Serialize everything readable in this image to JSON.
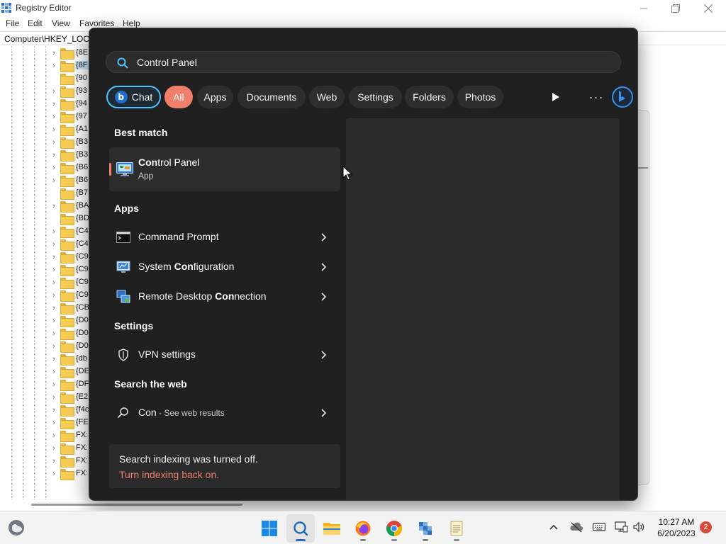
{
  "regedit": {
    "title": "Registry Editor",
    "menu": [
      "File",
      "Edit",
      "View",
      "Favorites",
      "Help"
    ],
    "address": "Computer\\HKEY_LOCA",
    "tree_items": [
      "{8E",
      "{8F",
      "{90",
      "{93",
      "{94",
      "{97",
      "{A1",
      "{B3",
      "{B3",
      "{B6",
      "{B6",
      "{B7",
      "{BA",
      "{BD",
      "{C4",
      "{C4",
      "{C9",
      "{C9",
      "{C9",
      "{C9",
      "{CB",
      "{D0",
      "{D0",
      "{D0",
      "{db",
      "{DE",
      "{DF",
      "{E2",
      "{f4c",
      "{FE",
      "FX:",
      "FX:",
      "FX:",
      "FX:"
    ],
    "selected_index": 1
  },
  "search": {
    "query": "Control Panel",
    "filters": [
      "Chat",
      "All",
      "Apps",
      "Documents",
      "Web",
      "Settings",
      "Folders",
      "Photos"
    ],
    "active_filter": "All",
    "more_label": "···",
    "best_match": {
      "heading": "Best match",
      "name_bold": "Con",
      "name_rest": "trol Panel",
      "type": "App"
    },
    "apps_heading": "Apps",
    "apps": [
      {
        "pre": "",
        "bold": "",
        "post": "Command Prompt",
        "icon": "command-prompt-icon"
      },
      {
        "pre": "System ",
        "bold": "Con",
        "post": "figuration",
        "icon": "system-configuration-icon"
      },
      {
        "pre": "Remote Desktop ",
        "bold": "Con",
        "post": "nection",
        "icon": "remote-desktop-icon"
      }
    ],
    "settings_heading": "Settings",
    "settings": [
      {
        "label": "VPN settings",
        "icon": "shield-icon"
      }
    ],
    "web_heading": "Search the web",
    "web": {
      "term": "Con",
      "suffix": " - See web results"
    },
    "index_notice": {
      "message": "Search indexing was turned off.",
      "link": "Turn indexing back on."
    }
  },
  "taskbar": {
    "time": "10:27 AM",
    "date": "6/20/2023",
    "notifications": "2",
    "apps": [
      "start-button",
      "search-button",
      "file-explorer",
      "firefox",
      "chrome",
      "registry-editor",
      "notepad"
    ]
  },
  "colors": {
    "accent": "#f07e6b",
    "chat_border": "#4cc2ff",
    "flyout_bg": "#202020",
    "taskbar_bg": "#f3f3f3"
  }
}
